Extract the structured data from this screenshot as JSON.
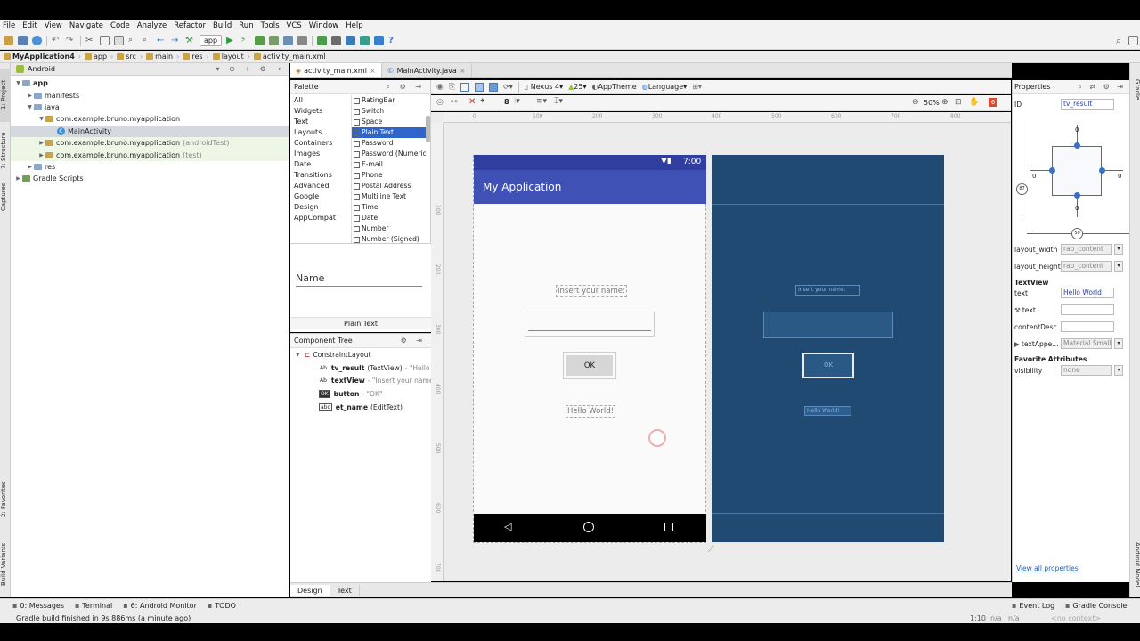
{
  "menu": [
    "File",
    "Edit",
    "View",
    "Navigate",
    "Code",
    "Analyze",
    "Refactor",
    "Build",
    "Run",
    "Tools",
    "VCS",
    "Window",
    "Help"
  ],
  "toolbar": {
    "config": "app"
  },
  "breadcrumb": [
    "MyApplication4",
    "app",
    "src",
    "main",
    "res",
    "layout",
    "activity_main.xml"
  ],
  "project": {
    "view": "Android",
    "tree": [
      {
        "label": "app",
        "depth": 0,
        "arrow": "▼",
        "icon": "folder"
      },
      {
        "label": "manifests",
        "depth": 1,
        "arrow": "▶",
        "icon": "folder"
      },
      {
        "label": "java",
        "depth": 1,
        "arrow": "▼",
        "icon": "folder"
      },
      {
        "label": "com.example.bruno.myapplication",
        "depth": 2,
        "arrow": "▼",
        "icon": "package",
        "suffix": ""
      },
      {
        "label": "MainActivity",
        "depth": 3,
        "arrow": "",
        "icon": "class",
        "selected": true
      },
      {
        "label": "com.example.bruno.myapplication",
        "depth": 2,
        "arrow": "▶",
        "icon": "package",
        "suffix": "(androidTest)",
        "green": true
      },
      {
        "label": "com.example.bruno.myapplication",
        "depth": 2,
        "arrow": "▶",
        "icon": "package",
        "suffix": "(test)",
        "green": true
      },
      {
        "label": "res",
        "depth": 1,
        "arrow": "▶",
        "icon": "folder"
      },
      {
        "label": "Gradle Scripts",
        "depth": 0,
        "arrow": "▶",
        "icon": "gradle"
      }
    ]
  },
  "left_strip": [
    "1: Project",
    "7: Structure",
    "Captures",
    "2: Favorites",
    "Build Variants"
  ],
  "tabs": [
    {
      "label": "activity_main.xml",
      "active": true
    },
    {
      "label": "MainActivity.java",
      "active": false
    }
  ],
  "palette": {
    "title": "Palette",
    "categories": [
      "All",
      "Widgets",
      "Text",
      "Layouts",
      "Containers",
      "Images",
      "Date",
      "Transitions",
      "Advanced",
      "Google",
      "Design",
      "AppCompat"
    ],
    "items": [
      "RatingBar",
      "Switch",
      "Space",
      "Plain Text",
      "Password",
      "Password (Numeric)",
      "E-mail",
      "Phone",
      "Postal Address",
      "Multiline Text",
      "Time",
      "Date",
      "Number",
      "Number (Signed)"
    ],
    "selected": "Plain Text",
    "preview_hint": "Name",
    "preview_label": "Plain Text"
  },
  "component_tree": {
    "title": "Component Tree",
    "root": "ConstraintLayout",
    "items": [
      {
        "id": "tv_result",
        "type": "(TextView)",
        "text": "- \"Hello W"
      },
      {
        "id": "textView",
        "type": "",
        "text": "- \"Insert your name:\""
      },
      {
        "id": "button",
        "type": "",
        "text": "- \"OK\""
      },
      {
        "id": "et_name",
        "type": "(EditText)",
        "text": ""
      }
    ]
  },
  "design_toolbar": {
    "device": "Nexus 4",
    "api": "25",
    "theme": "AppTheme",
    "language": "Language",
    "zoom": "50%"
  },
  "ruler": {
    "top": [
      "0",
      "100",
      "200",
      "300",
      "400",
      "500",
      "600",
      "700",
      "800"
    ],
    "left": [
      "100",
      "200",
      "300",
      "400",
      "500",
      "600",
      "700"
    ]
  },
  "phone": {
    "time": "7:00",
    "title": "My Application",
    "label_prompt": "Insert your name:",
    "button": "OK",
    "result": "Hello World!"
  },
  "blueprint": {
    "label_prompt": "Insert your name:",
    "button": "OK",
    "result": "Hello World!"
  },
  "design_tabs": [
    "Design",
    "Text"
  ],
  "properties": {
    "title": "Properties",
    "id_label": "ID",
    "id_value": "tv_result",
    "rows": [
      {
        "label": "layout_width",
        "value": "rap_content"
      },
      {
        "label": "layout_height",
        "value": "rap_content"
      }
    ],
    "section": "TextView",
    "text_rows": [
      {
        "label": "text",
        "value": "Hello World!"
      },
      {
        "label": "text",
        "value": ""
      },
      {
        "label": "contentDesc...",
        "value": ""
      },
      {
        "label": "textAppe...",
        "value": "Material.Small"
      }
    ],
    "fav_section": "Favorite Attributes",
    "fav_rows": [
      {
        "label": "visibility",
        "value": "none"
      }
    ],
    "link": "View all properties",
    "constraint": {
      "top": "0",
      "bottom": "0",
      "left": "0",
      "right": "0",
      "bias": "50",
      "left_val": "87"
    }
  },
  "right_strip": [
    "Gradle",
    "Android Model"
  ],
  "bottom_tools": [
    "0: Messages",
    "Terminal",
    "6: Android Monitor",
    "TODO"
  ],
  "bottom_right": [
    "Event Log",
    "Gradle Console"
  ],
  "status": {
    "message": "Gradle build finished in 9s 886ms (a minute ago)",
    "pos": "1:10",
    "na1": "n/a",
    "na2": "n/a",
    "context": "<no context>"
  },
  "colors": {
    "primary": "#3f51b5",
    "primary_dark": "#303f9f",
    "blueprint": "#204a72",
    "selection": "#2f65ca"
  }
}
